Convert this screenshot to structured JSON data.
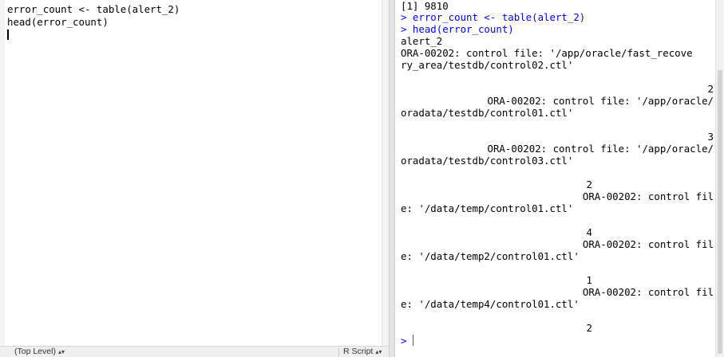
{
  "editor": {
    "lines": [
      "error_count <- table(alert_2)",
      "head(error_count)"
    ],
    "status": {
      "scope": "(Top Level)",
      "language": "R Script",
      "arrow_icon": "updown-arrows-icon"
    }
  },
  "console": {
    "lines": [
      "[1] 9810",
      "> error_count <- table(alert_2)",
      "> head(error_count)",
      "alert_2",
      "ORA-00202: control file: '/app/oracle/fast_recove",
      "ry_area/testdb/control02.ctl'",
      "2",
      "ORA-00202: control file: '/app/oracle/",
      "oradata/testdb/control01.ctl'",
      "3",
      "ORA-00202: control file: '/app/oracle/",
      "oradata/testdb/control03.ctl'",
      "2",
      "ORA-00202: control fil",
      "e: '/data/temp/control01.ctl'",
      "4",
      "ORA-00202: control fil",
      "e: '/data/temp2/control01.ctl'",
      "1",
      "ORA-00202: control fil",
      "e: '/data/temp4/control01.ctl'",
      "2"
    ],
    "prompt": ">"
  },
  "colors": {
    "command": "#0000ff",
    "output": "#000000"
  }
}
